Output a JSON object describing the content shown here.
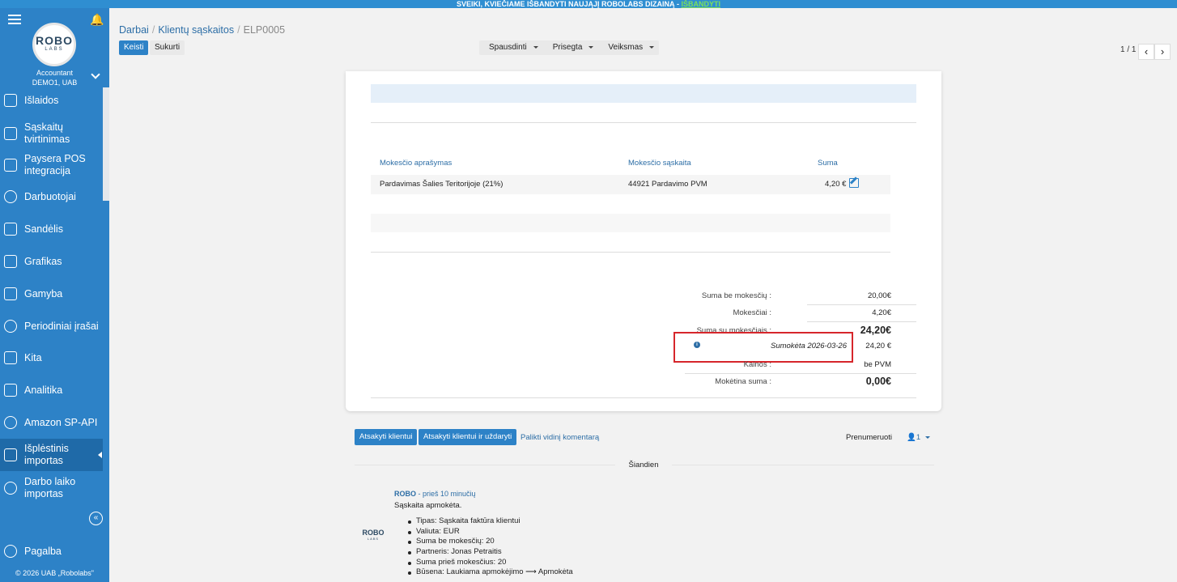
{
  "banner": {
    "text": "SVEIKI, KVIEČIAME IŠBANDYTI NAUJĄJĮ ROBOLABS DIZAINĄ - ",
    "link": "IŠBANDYTI"
  },
  "sidebar": {
    "logo_top": "ROBO",
    "logo_bottom": "LABS",
    "account_role": "Accountant",
    "account_company": "DEMO1, UAB",
    "items": [
      {
        "label": "Išlaidos",
        "icon": "money-icon"
      },
      {
        "label": "Sąskaitų tvirtinimas",
        "icon": "eye-document-icon"
      },
      {
        "label": "Paysera POS integracija",
        "icon": "wallet-icon"
      },
      {
        "label": "Darbuotojai",
        "icon": "user-icon"
      },
      {
        "label": "Sandėlis",
        "icon": "truck-icon"
      },
      {
        "label": "Grafikas",
        "icon": "calendar-user-icon"
      },
      {
        "label": "Gamyba",
        "icon": "factory-icon"
      },
      {
        "label": "Periodiniai įrašai",
        "icon": "refresh-icon"
      },
      {
        "label": "Kita",
        "icon": "list-icon"
      },
      {
        "label": "Analitika",
        "icon": "bar-chart-icon"
      },
      {
        "label": "Amazon SP-API",
        "icon": "cloud-icon"
      },
      {
        "label": "Išplėstinis importas",
        "icon": "import-icon"
      },
      {
        "label": "Darbo laiko importas",
        "icon": "clock-icon"
      },
      {
        "label": "Pagalba",
        "icon": "help-icon"
      }
    ],
    "copyright": "© 2026 UAB „Robolabs\""
  },
  "breadcrumb": {
    "items": [
      "Darbai",
      "Klientų sąskaitos",
      "ELP0005"
    ]
  },
  "actions": {
    "edit": "Keisti",
    "create": "Sukurti",
    "print": "Spausdinti",
    "attached": "Prisegta",
    "actions": "Veiksmas"
  },
  "pager": {
    "text": "1 / 1"
  },
  "tax_table": {
    "headers": [
      "Mokesčio aprašymas",
      "Mokesčio sąskaita",
      "Suma"
    ],
    "rows": [
      {
        "description": "Pardavimas Šalies Teritorijoje (21%)",
        "account": "44921 Pardavimo PVM",
        "amount": "4,20 €"
      }
    ]
  },
  "totals": {
    "untaxed_label": "Suma be mokesčių :",
    "untaxed_value": "20,00€",
    "taxes_label": "Mokesčiai :",
    "taxes_value": "4,20€",
    "total_label": "Suma su mokesčiais :",
    "total_value": "24,20€",
    "paid_label": "Sumokėta 2026-03-26",
    "paid_value": "24,20 €",
    "prices_label": "Kainos :",
    "prices_value": "be PVM",
    "due_label": "Mokėtina suma :",
    "due_value": "0,00€"
  },
  "chatter": {
    "reply": "Atsakyti klientui",
    "reply_close": "Atsakyti klientui ir uždaryti",
    "internal_note": "Palikti vidinį komentarą",
    "subscribe": "Prenumeruoti",
    "followers": "1",
    "today": "Šiandien",
    "message": {
      "author": "ROBO",
      "time": " - prieš 10 minučių",
      "text": "Sąskaita apmokėta.",
      "avatar_top": "ROBO",
      "avatar_bottom": "LABS",
      "changes": [
        "Tipas: Sąskaita faktūra klientui",
        "Valiuta: EUR",
        "Suma be mokesčių: 20",
        "Partneris: Jonas Petraitis",
        "Suma prieš mokesčius: 20",
        "Būsena: Laukiama apmokėjimo ⟶ Apmokėta"
      ]
    }
  }
}
